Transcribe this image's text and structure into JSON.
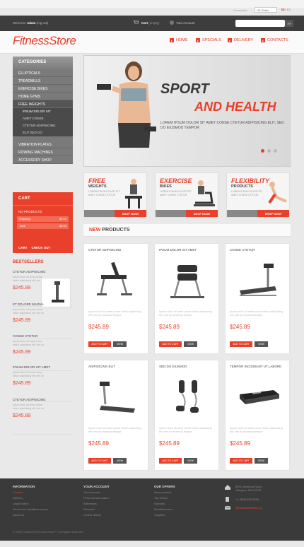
{
  "top": {
    "currency_label": "Currencies",
    "currency_value": "US Dollar",
    "lang_en": "En",
    "lang_es": "Es"
  },
  "header": {
    "welcome_prefix": "Welcome ",
    "user": "Adam",
    "logout": "(log out)",
    "cart_label": "Cart",
    "cart_state": "(empty)",
    "account": "Your Account",
    "search_placeholder": "",
    "search_button": ">>"
  },
  "logo": {
    "part1": "Fitness",
    "part2": "Store"
  },
  "menu": [
    "HOME",
    "SPECIALS",
    "DELIVERY",
    "CONTACTS"
  ],
  "categories": {
    "title": "CATEGORIES",
    "items": [
      "ELLIPTICALS",
      "TREADMILLS",
      "EXERCISE BIKES",
      "HOME GYMS",
      "FREE WEIGHTS"
    ],
    "sub_items": [
      "IPSUM DOLOR SIT",
      "AMET CONSE",
      "CTETUR ADIPISICING",
      "ELIT SED DO"
    ],
    "items_after": [
      "VIBRATION PLATES",
      "ROWING MACHINES",
      "ACCESSORY SHOP"
    ]
  },
  "cart": {
    "title": "CART",
    "no_products": "NO PRODUCTS",
    "shipping_label": "Shipping",
    "shipping_value": "$0.00",
    "total_label": "Total",
    "total_value": "$0.00",
    "cart_link": "CART",
    "checkout_link": "CHECK OUT"
  },
  "hero": {
    "line1": "SPORT",
    "line2": "AND HEALTH",
    "text": "LOREM IPSUM DOLOR SIT AMET CONSE CTETUR ADIPISICING ELIT, SED DO EIUSMOD TEMPOR"
  },
  "promos": [
    {
      "title": "FREE",
      "subtitle": "WEIGHTS",
      "text": "LOREM IPSUM DOLOR SIT AMET CONSE CTETUR",
      "button": "SHOP NOW!"
    },
    {
      "title": "EXERCISE",
      "subtitle": "BIKES",
      "text": "LOREM IPSUM DOLOR SIT AMET CONSE CTETUR",
      "button": "SHOP NOW!"
    },
    {
      "title": "FLEXIBILITY",
      "subtitle": "PRODUCTS",
      "text": "LOREM IPSUM DOLOR SIT AMET CONSE CTETUR",
      "button": "SHOP NOW!"
    }
  ],
  "new_products": {
    "title_accent": "NEW ",
    "title_rest": "PRODUCTS"
  },
  "products": [
    {
      "name": "CTETUR ADIPISICING",
      "desc": "Ipsum dolor sit amet conse ctetur adipisicing elit, sed do eiusmod tempor",
      "price": "$245.89",
      "add": "ADD TO CART",
      "view": "VIEW"
    },
    {
      "name": "IPSUM DOLOR SIT AMET",
      "desc": "Ipsum dolor sit amet conse ctetur adipisicing elit, sed do eiusmod tempor",
      "price": "$245.89",
      "add": "ADD TO CART",
      "view": "VIEW"
    },
    {
      "name": "CONSE CTETUR",
      "desc": "Ipsum dolor sit amet conse ctetur adipisicing elit, sed do eiusmod tempor",
      "price": "$245.89",
      "add": "ADD TO CART",
      "view": "VIEW"
    },
    {
      "name": "ADIPISICING ELIT",
      "desc": "Ipsum dolor sit amet conse ctetur adipisicing elit, sed do eiusmod tempor",
      "price": "$245.89",
      "add": "ADD TO CART",
      "view": "VIEW"
    },
    {
      "name": "SED DO EIUSMOD",
      "desc": "Ipsum dolor sit amet conse ctetur adipisicing elit, sed do eiusmod tempor",
      "price": "$245.89",
      "add": "ADD TO CART",
      "view": "VIEW"
    },
    {
      "name": "TEMPOR INCIDIDUNT UT LABORE",
      "desc": "Ipsum dolor sit amet conse ctetur adipisicing elit, sed do eiusmod tempor",
      "price": "$245.89",
      "add": "ADD TO CART",
      "view": "VIEW"
    }
  ],
  "bestsellers": {
    "title": "BESTSELLERS",
    "items": [
      {
        "name": "CTETUR ADIPISICING",
        "desc": "Ipsum dolor sit amet conse ctetur adipisicing elit, sed do",
        "price": "$245.89"
      },
      {
        "name": "ET DOLORE MAGNA",
        "desc": "Ipsum dolor sit amet conse ctetur adipisicing elit, sed do",
        "price": "$245.89"
      },
      {
        "name": "CONSE CTETUR",
        "desc": "Ipsum dolor sit amet conse ctetur adipisicing elit, sed do",
        "price": "$245.89"
      },
      {
        "name": "IPSUM DOLOR SIT AMET",
        "desc": "Ipsum dolor sit amet conse ctetur adipisicing elit, sed do",
        "price": "$245.89"
      },
      {
        "name": "CTETUR ADIPISICING",
        "desc": "Ipsum dolor sit amet conse ctetur adipisicing elit, sed do",
        "price": "$245.89"
      }
    ]
  },
  "footer": {
    "info_title": "INFORMATION",
    "info_links": [
      "Contact",
      "Delivery",
      "Legal Notice",
      "Terms and conditions of use",
      "About us"
    ],
    "account_title": "YOUR ACCOUNT",
    "account_links": [
      "Your Account",
      "Personal information",
      "Addresses",
      "Discount",
      "Orders history"
    ],
    "offers_title": "OUR OFFERS",
    "offers_links": [
      "New products",
      "Top sellers",
      "Specials",
      "Manufacturers",
      "Suppliers"
    ],
    "address": "8901 Marmora Road, Glasgow, D04 89GR",
    "phone": "+1 (555) 555-5555",
    "email": "admin@demolink.org",
    "copyright": "© 2012 Powered by Presta Shop™. All Rights Reserved"
  },
  "colors": {
    "accent": "#e8402a",
    "dark": "#3a3a3a"
  }
}
